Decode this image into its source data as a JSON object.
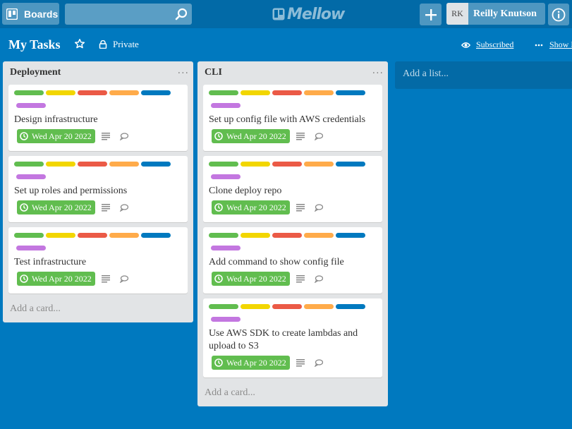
{
  "topbar": {
    "boards_label": "Boards",
    "search_value": "",
    "search_placeholder": "",
    "logo_text": "Mellow",
    "user_initials": "RK",
    "user_name": "Reilly Knutson"
  },
  "board": {
    "title": "My Tasks",
    "visibility": "Private",
    "subscribed_label": "Subscribed",
    "show_menu_label": "Show Menu"
  },
  "label_colors": [
    "#61bd4f",
    "#f2d600",
    "#eb5a46",
    "#ffab4a",
    "#0079bf",
    "#c377e0"
  ],
  "lists": [
    {
      "title": "Deployment",
      "menu": "···",
      "add_card": "Add a card...",
      "cards": [
        {
          "title": "Design infrastructure",
          "due": "Wed Apr 20 2022"
        },
        {
          "title": "Set up roles and permissions",
          "due": "Wed Apr 20 2022"
        },
        {
          "title": "Test infrastructure",
          "due": "Wed Apr 20 2022"
        }
      ]
    },
    {
      "title": "CLI",
      "menu": "···",
      "add_card": "Add a card...",
      "cards": [
        {
          "title": "Set up config file with AWS credentials",
          "due": "Wed Apr 20 2022"
        },
        {
          "title": "Clone deploy repo",
          "due": "Wed Apr 20 2022"
        },
        {
          "title": "Add command to show config file",
          "due": "Wed Apr 20 2022"
        },
        {
          "title": "Use AWS SDK to create lambdas and upload to S3",
          "due": "Wed Apr 20 2022"
        }
      ]
    }
  ],
  "add_list_label": "Add a list..."
}
